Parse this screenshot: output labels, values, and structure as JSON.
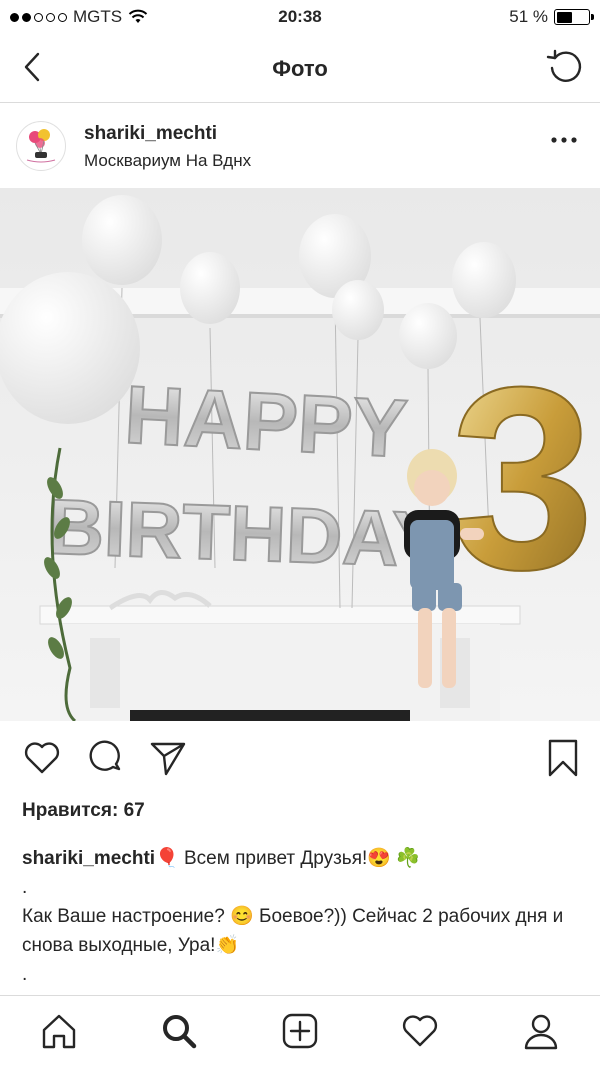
{
  "status": {
    "carrier": "MGTS",
    "time": "20:38",
    "battery": "51 %",
    "battery_level": 0.51
  },
  "nav": {
    "title": "Фото",
    "back_icon": "chevron-left-icon",
    "refresh_icon": "refresh-icon"
  },
  "post": {
    "username": "shariki_mechti",
    "location": "Москвариум На Вднх",
    "likes": "Нравится: 67",
    "caption_user": "shariki_mechti",
    "caption_line1": "🎈 Всем привет Друзья!😍 ☘️",
    "caption_dot1": ".",
    "caption_line2": "Как Ваше настроение? 😊  Боевое?)) Сейчас 2 рабочих дня и снова выходные, Ура!👏",
    "caption_dot2": ".",
    "photo_text": [
      "HAPPY",
      "BIRTHDAY",
      "3"
    ]
  },
  "colors": {
    "accent": "#262626",
    "divider": "#dbdbdb",
    "gold": "#d4b04a",
    "silver": "#c9c9c9"
  }
}
